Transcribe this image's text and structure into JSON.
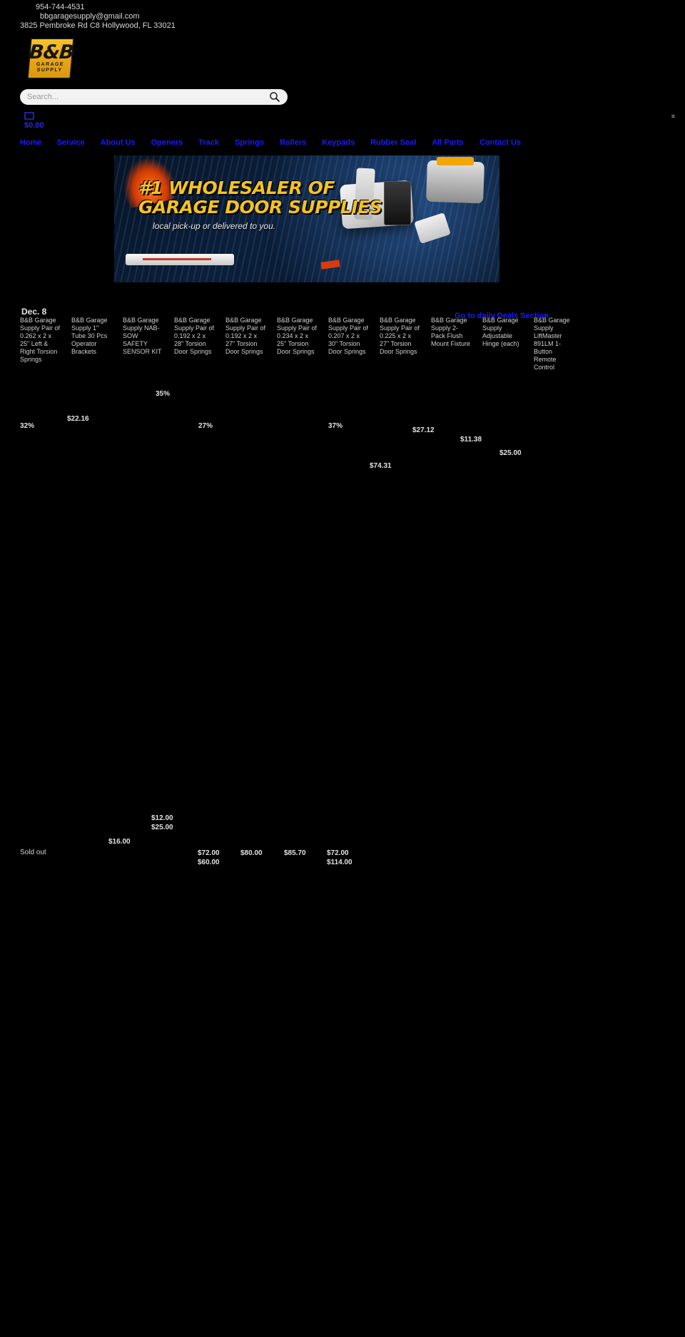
{
  "contact": {
    "phone": "954-744-4531",
    "email": "bbgaragesupply@gmail.com",
    "address": "3825 Pembroke Rd C8 Hollywood, FL 33021"
  },
  "logo": {
    "main": "B&B",
    "line1": "GARAGE",
    "line2": "SUPPLY"
  },
  "search": {
    "placeholder": "Search...",
    "value": "",
    "icon": "search-icon"
  },
  "cart": {
    "icon": "cart-icon",
    "total": "$0.00"
  },
  "menu_toggle": "≡",
  "nav": {
    "items": [
      {
        "label": "Home"
      },
      {
        "label": "Service"
      },
      {
        "label": "About Us"
      },
      {
        "label": "Openers"
      },
      {
        "label": "Track"
      },
      {
        "label": "Springs"
      },
      {
        "label": "Rollers"
      },
      {
        "label": "Keypads"
      },
      {
        "label": "Rubber Seal"
      },
      {
        "label": "All Parts"
      },
      {
        "label": "Contact Us"
      }
    ]
  },
  "hero": {
    "line1": "#1 WHOLESALER OF",
    "line2": "GARAGE DOOR SUPPLIES",
    "subtitle": "local pick-up or delivered to you."
  },
  "deals": {
    "title": "Dec. 8",
    "link": "Go to daily Deals Section",
    "arrow": "›"
  },
  "products": [
    {
      "title": "B&B Garage Supply Pair of 0.262 x 2 x 25\" Left & Right Torsion Springs",
      "badge": "32%",
      "price": ""
    },
    {
      "title": "B&B Garage Supply 1\" Tube 30 Pcs Operator Brackets",
      "badge": "",
      "price": "$22.16"
    },
    {
      "title": "B&B Garage Supply NAB-SOW SAFETY SENSOR KIT",
      "badge": "35%",
      "price": ""
    },
    {
      "title": "B&B Garage Supply Pair of 0.192 x 2 x 28\" Torsion Door Springs",
      "badge": "27%",
      "price": ""
    },
    {
      "title": "B&B Garage Supply Pair of 0.192 x 2 x 27\" Torsion Door Springs",
      "badge": "",
      "price": ""
    },
    {
      "title": "B&B Garage Supply Pair of 0.234 x 2 x 25\" Torsion Door Springs",
      "badge": "37%",
      "price": ""
    },
    {
      "title": "B&B Garage Supply Pair of 0.207 x 2 x 30\" Torsion Door Springs",
      "badge": "",
      "price": "$27.12"
    },
    {
      "title": "B&B Garage Supply Pair of 0.225 x 2 x 27\" Torsion Door Springs",
      "badge": "",
      "price": "$11.38"
    },
    {
      "title": "B&B Garage Supply 2-Pack Flush Mount Fixture",
      "badge": "",
      "price": "$74.31"
    },
    {
      "title": "B&B Garage Supply Adjustable Hinge (each)",
      "badge": "",
      "price": "$25.00"
    },
    {
      "title": "B&B Garage Supply LiftMaster 891LM 1-Button Remote Control",
      "badge": "",
      "price": ""
    }
  ],
  "extra_prices": [
    {
      "value": "$12.00"
    },
    {
      "value": "$25.00"
    },
    {
      "value": "$16.00"
    },
    {
      "value": "$72.00"
    },
    {
      "value": "$60.00"
    },
    {
      "value": "$80.00"
    },
    {
      "value": "$85.70"
    },
    {
      "value": "$72.00"
    },
    {
      "value": "$114.00"
    }
  ],
  "status": {
    "sold_out": "Sold out"
  },
  "colors": {
    "brand_yellow": "#f0b81c",
    "link_blue": "#1a1aff",
    "background": "#000000",
    "text": "#d8d8d8"
  }
}
